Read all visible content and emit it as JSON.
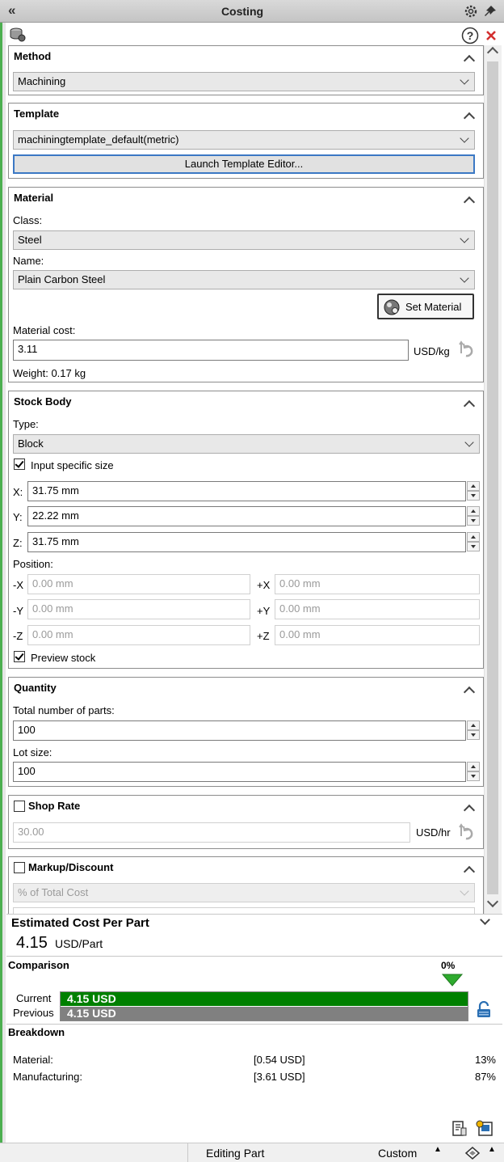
{
  "window": {
    "title": "Costing"
  },
  "method": {
    "title": "Method",
    "value": "Machining"
  },
  "template": {
    "title": "Template",
    "value": "machiningtemplate_default(metric)",
    "launch_label": "Launch Template Editor..."
  },
  "material": {
    "title": "Material",
    "class_label": "Class:",
    "class_value": "Steel",
    "name_label": "Name:",
    "name_value": "Plain Carbon Steel",
    "set_material_label": "Set Material",
    "cost_label": "Material cost:",
    "cost_value": "3.11",
    "cost_unit": "USD/kg",
    "weight": "Weight: 0.17 kg"
  },
  "stock_body": {
    "title": "Stock Body",
    "type_label": "Type:",
    "type_value": "Block",
    "specific_size_label": "Input specific size",
    "x_label": "X:",
    "x_value": "31.75 mm",
    "y_label": "Y:",
    "y_value": "22.22 mm",
    "z_label": "Z:",
    "z_value": "31.75 mm",
    "position_label": "Position:",
    "neg_x_label": "-X",
    "neg_x_value": "0.00 mm",
    "pos_x_label": "+X",
    "pos_x_value": "0.00 mm",
    "neg_y_label": "-Y",
    "neg_y_value": "0.00 mm",
    "pos_y_label": "+Y",
    "pos_y_value": "0.00 mm",
    "neg_z_label": "-Z",
    "neg_z_value": "0.00 mm",
    "pos_z_label": "+Z",
    "pos_z_value": "0.00 mm",
    "preview_label": "Preview stock"
  },
  "quantity": {
    "title": "Quantity",
    "total_label": "Total number of parts:",
    "total_value": "100",
    "lot_label": "Lot size:",
    "lot_value": "100"
  },
  "shop_rate": {
    "title": "Shop Rate",
    "value": "30.00",
    "unit": "USD/hr"
  },
  "markup": {
    "title": "Markup/Discount",
    "type_value": "% of Total Cost"
  },
  "estimate": {
    "title": "Estimated Cost Per Part",
    "value": "4.15",
    "unit": "USD/Part"
  },
  "comparison": {
    "title": "Comparison",
    "percent": "0%",
    "current_label": "Current",
    "current_value": "4.15 USD",
    "previous_label": "Previous",
    "previous_value": "4.15 USD",
    "current_fraction": 1.0,
    "previous_fraction": 1.0
  },
  "breakdown": {
    "title": "Breakdown",
    "rows": [
      {
        "label": "Material:",
        "value": "[0.54 USD]",
        "percent": "13%"
      },
      {
        "label": "Manufacturing:",
        "value": "[3.61 USD]",
        "percent": "87%"
      }
    ]
  },
  "status": {
    "mode": "Editing Part",
    "units": "Custom"
  },
  "colors": {
    "current_bar": "#008000",
    "previous_bar": "#808080",
    "close_red": "#d32f2f"
  }
}
